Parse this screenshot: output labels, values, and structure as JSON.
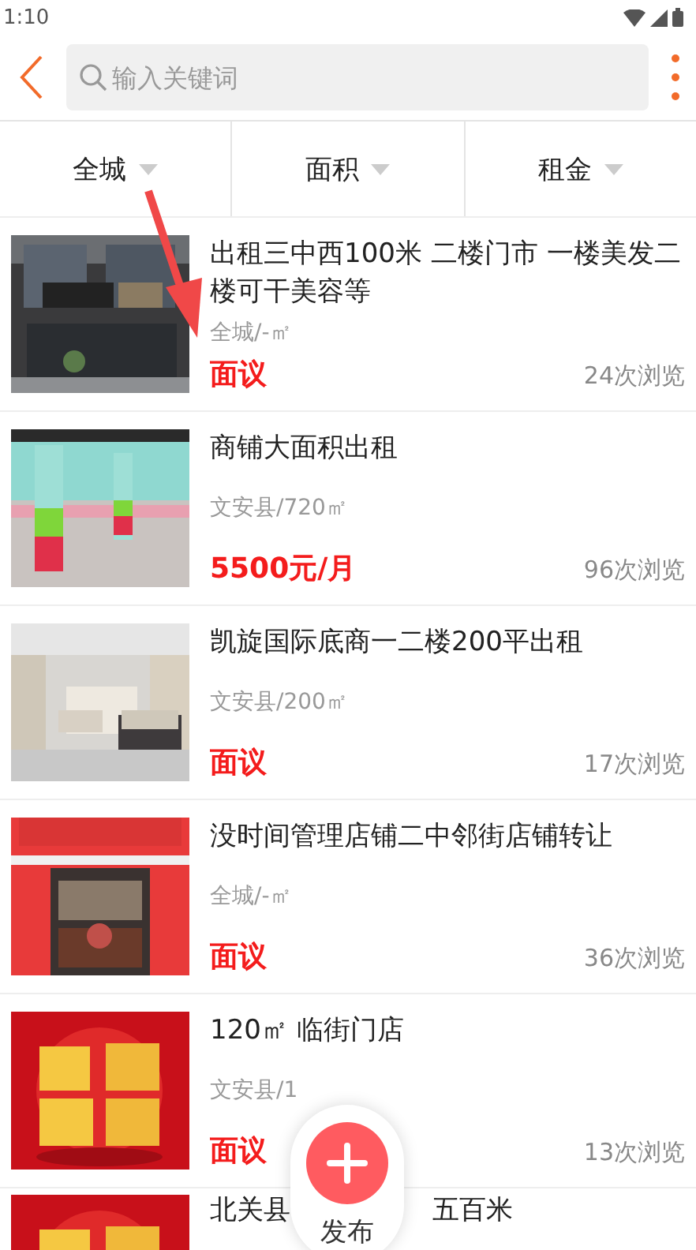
{
  "status_bar": {
    "time": "1:10"
  },
  "search": {
    "placeholder": "输入关键词"
  },
  "filters": [
    {
      "label": "全城"
    },
    {
      "label": "面积"
    },
    {
      "label": "租金"
    }
  ],
  "listings": [
    {
      "title": "出租三中西100米 二楼门市 一楼美发二楼可干美容等",
      "location": "全城/-㎡",
      "price": "面议",
      "views": "24次浏览"
    },
    {
      "title": "商铺大面积出租",
      "location": "文安县/720㎡",
      "price": "5500元/月",
      "views": "96次浏览"
    },
    {
      "title": "凯旋国际底商一二楼200平出租",
      "location": "文安县/200㎡",
      "price": "面议",
      "views": "17次浏览"
    },
    {
      "title": "没时间管理店铺二中邻街店铺转让",
      "location": "全城/-㎡",
      "price": "面议",
      "views": "36次浏览"
    },
    {
      "title": "120㎡ 临街门店",
      "location": "文安县/1",
      "price": "面议",
      "views": "13次浏览"
    }
  ],
  "partial_listing": {
    "title_parts": [
      "北关县",
      "五百米"
    ]
  },
  "fab": {
    "label": "发布"
  }
}
